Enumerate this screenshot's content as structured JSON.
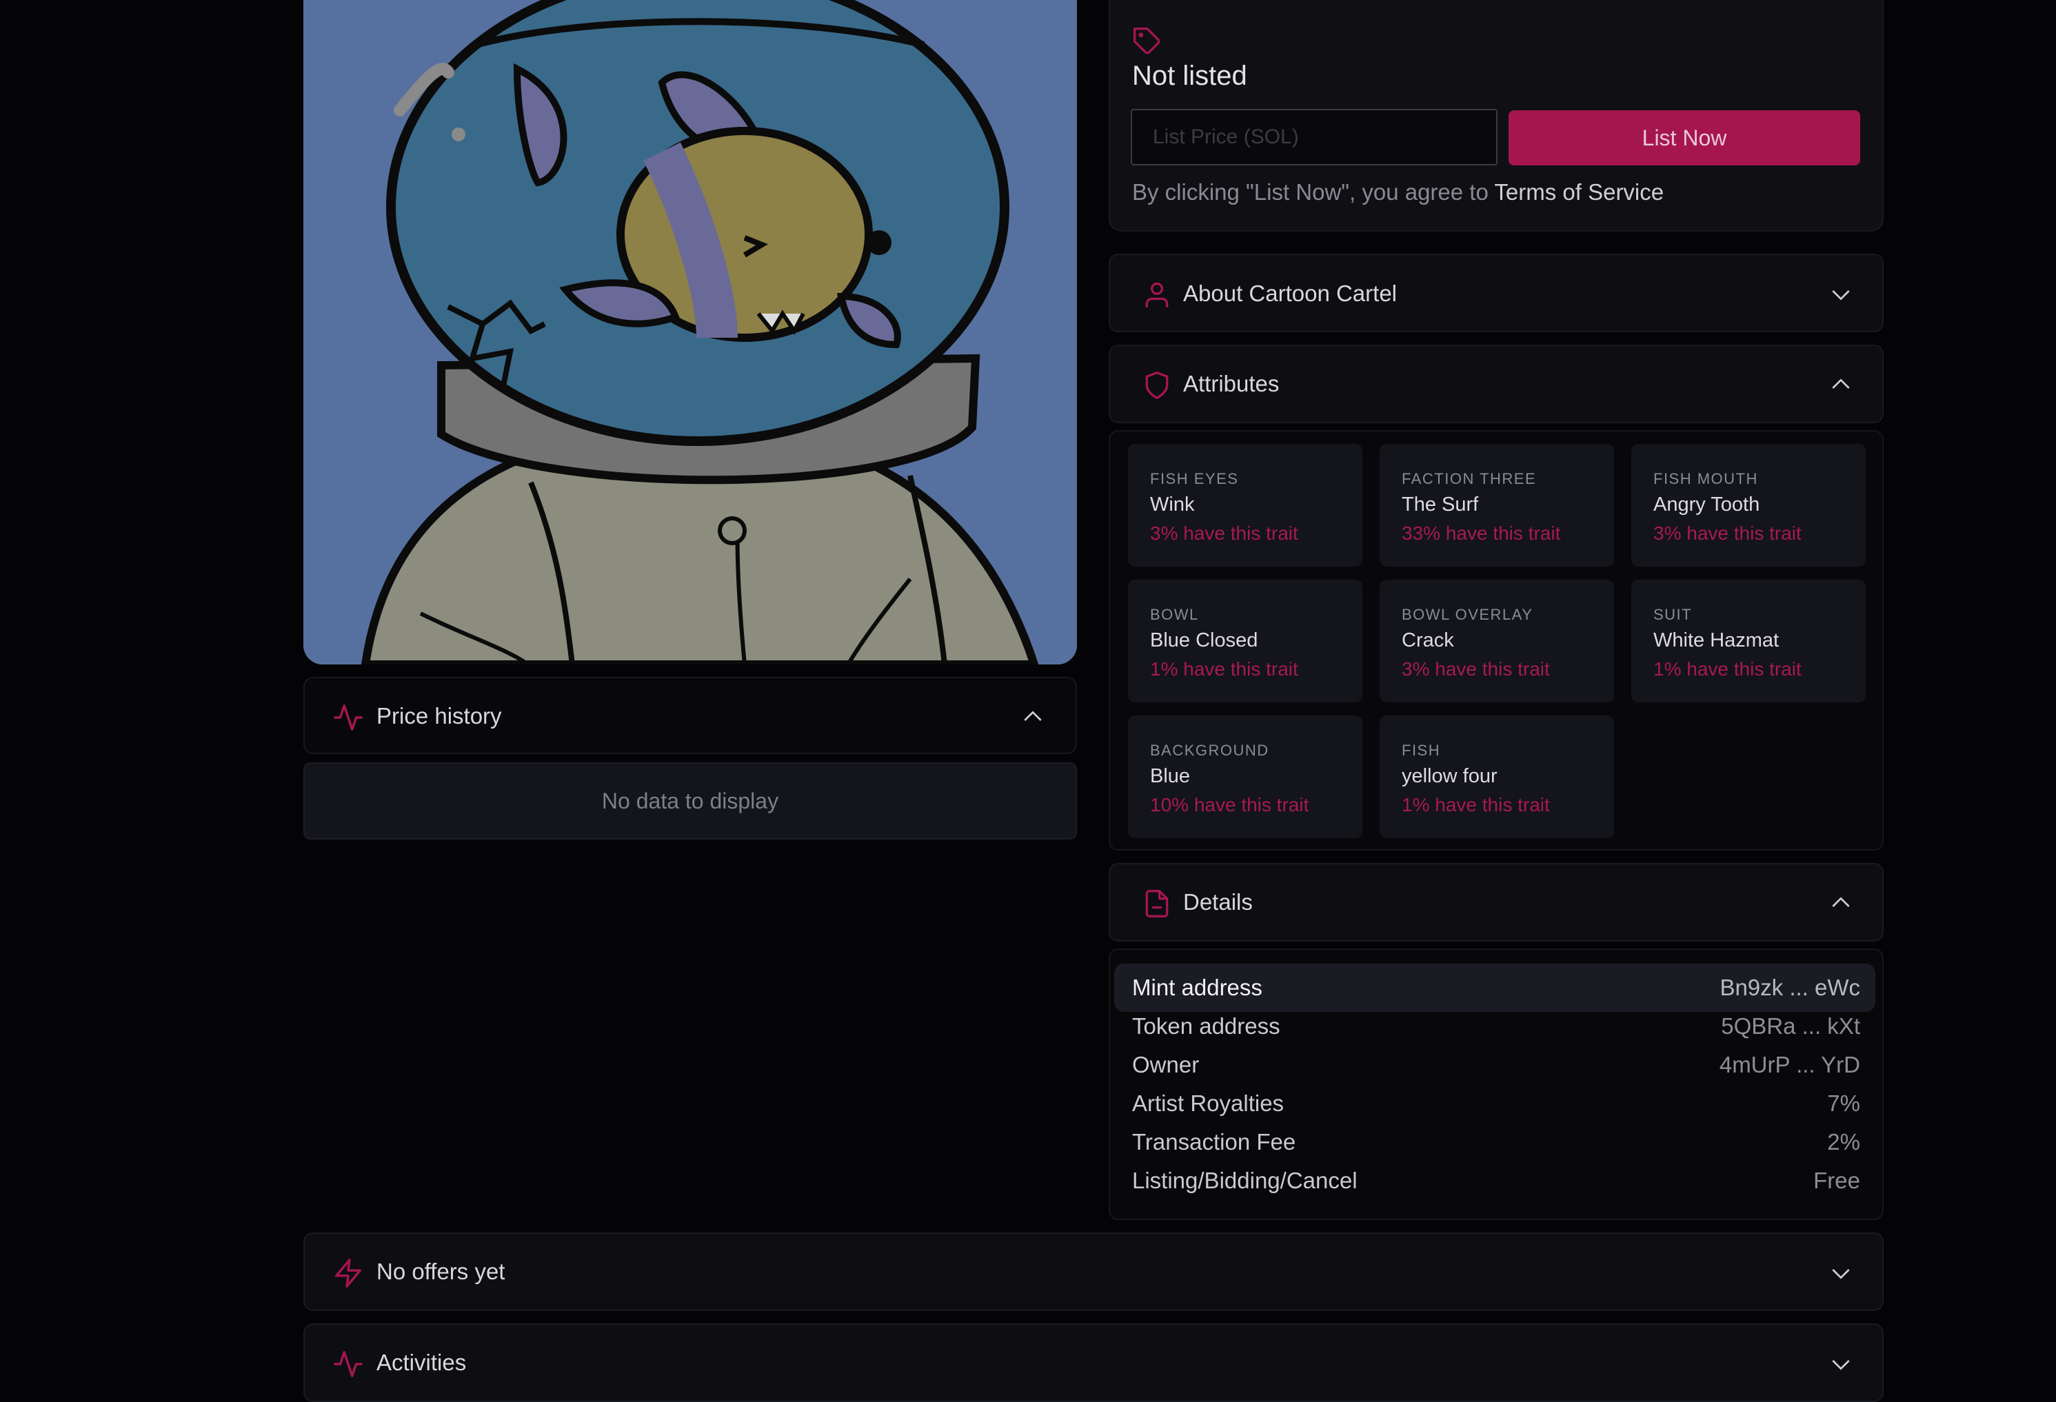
{
  "listing": {
    "status": "Not listed",
    "price_placeholder": "List Price (SOL)",
    "list_button": "List Now",
    "agree_prefix": "By clicking \"List Now\", you agree to ",
    "terms_link": "Terms of Service"
  },
  "about": {
    "title": "About Cartoon Cartel"
  },
  "attributes": {
    "title": "Attributes",
    "traits": [
      {
        "type": "FISH EYES",
        "value": "Wink",
        "rarity": "3% have this trait"
      },
      {
        "type": "FACTION THREE",
        "value": "The Surf",
        "rarity": "33% have this trait"
      },
      {
        "type": "FISH MOUTH",
        "value": "Angry Tooth",
        "rarity": "3% have this trait"
      },
      {
        "type": "BOWL",
        "value": "Blue Closed",
        "rarity": "1% have this trait"
      },
      {
        "type": "BOWL OVERLAY",
        "value": "Crack",
        "rarity": "3% have this trait"
      },
      {
        "type": "SUIT",
        "value": "White Hazmat",
        "rarity": "1% have this trait"
      },
      {
        "type": "BACKGROUND",
        "value": "Blue",
        "rarity": "10% have this trait"
      },
      {
        "type": "FISH",
        "value": "yellow four",
        "rarity": "1% have this trait"
      }
    ]
  },
  "details": {
    "title": "Details",
    "rows": [
      {
        "label": "Mint address",
        "value": "Bn9zk ... eWc"
      },
      {
        "label": "Token address",
        "value": "5QBRa ... kXt"
      },
      {
        "label": "Owner",
        "value": "4mUrP ... YrD"
      },
      {
        "label": "Artist Royalties",
        "value": "7%"
      },
      {
        "label": "Transaction Fee",
        "value": "2%"
      },
      {
        "label": "Listing/Bidding/Cancel",
        "value": "Free"
      }
    ]
  },
  "price_history": {
    "title": "Price history",
    "empty": "No data to display"
  },
  "offers": {
    "title": "No offers yet"
  },
  "activities": {
    "title": "Activities"
  },
  "colors": {
    "accent": "#a6164e",
    "background": "#040406",
    "panel": "#0d0d12"
  },
  "icons": [
    "tag-icon",
    "user-icon",
    "shield-icon",
    "document-icon",
    "activity-icon",
    "lightning-icon",
    "chevron-down-icon",
    "chevron-up-icon"
  ]
}
